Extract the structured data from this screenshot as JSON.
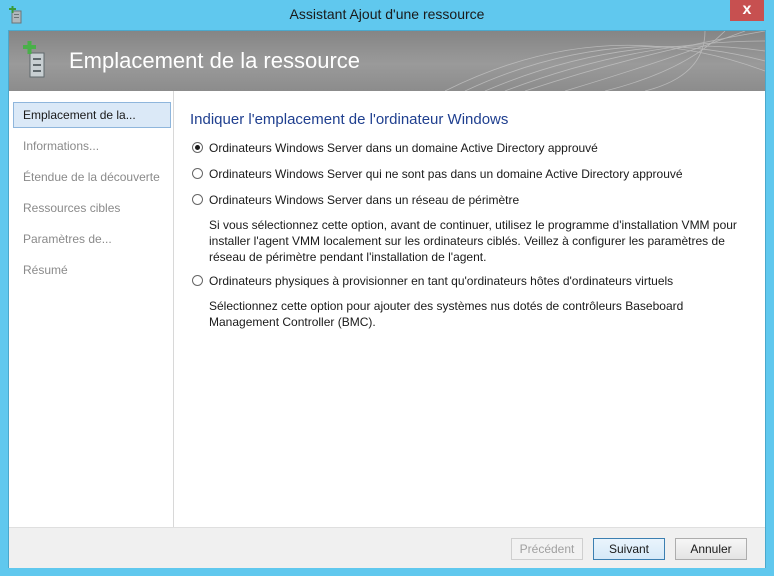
{
  "window": {
    "title": "Assistant Ajout d'une ressource",
    "close_glyph": "x"
  },
  "banner": {
    "title": "Emplacement de la ressource"
  },
  "sidebar": {
    "items": [
      {
        "label": "Emplacement de la...",
        "active": true
      },
      {
        "label": "Informations...",
        "active": false
      },
      {
        "label": "Étendue de la découverte",
        "active": false
      },
      {
        "label": "Ressources cibles",
        "active": false
      },
      {
        "label": "Paramètres de...",
        "active": false
      },
      {
        "label": "Résumé",
        "active": false
      }
    ]
  },
  "main": {
    "heading": "Indiquer l'emplacement de l'ordinateur Windows",
    "options": [
      {
        "label": "Ordinateurs Windows Server dans un domaine Active Directory approuvé",
        "checked": true
      },
      {
        "label": "Ordinateurs Windows Server qui ne sont pas dans un domaine Active Directory approuvé",
        "checked": false
      },
      {
        "label": "Ordinateurs Windows Server dans un réseau de périmètre",
        "checked": false,
        "description": "Si vous sélectionnez cette option, avant de continuer, utilisez le programme d'installation VMM pour installer l'agent VMM localement sur les ordinateurs ciblés. Veillez à configurer les paramètres de réseau de périmètre pendant l'installation de l'agent."
      },
      {
        "label": "Ordinateurs physiques à provisionner en tant qu'ordinateurs hôtes d'ordinateurs virtuels",
        "checked": false,
        "description": "Sélectionnez cette option pour ajouter des systèmes nus dotés de contrôleurs Baseboard Management Controller (BMC)."
      }
    ]
  },
  "footer": {
    "previous_label": "Précédent",
    "next_label": "Suivant",
    "cancel_label": "Annuler"
  },
  "icons": {
    "title_icon": "add-server-icon",
    "banner_icon": "add-server-icon"
  },
  "colors": {
    "window_frame": "#60c8ee",
    "heading": "#1f3f8f",
    "close_button": "#c75050",
    "nav_active_bg": "#dbe9f7"
  }
}
